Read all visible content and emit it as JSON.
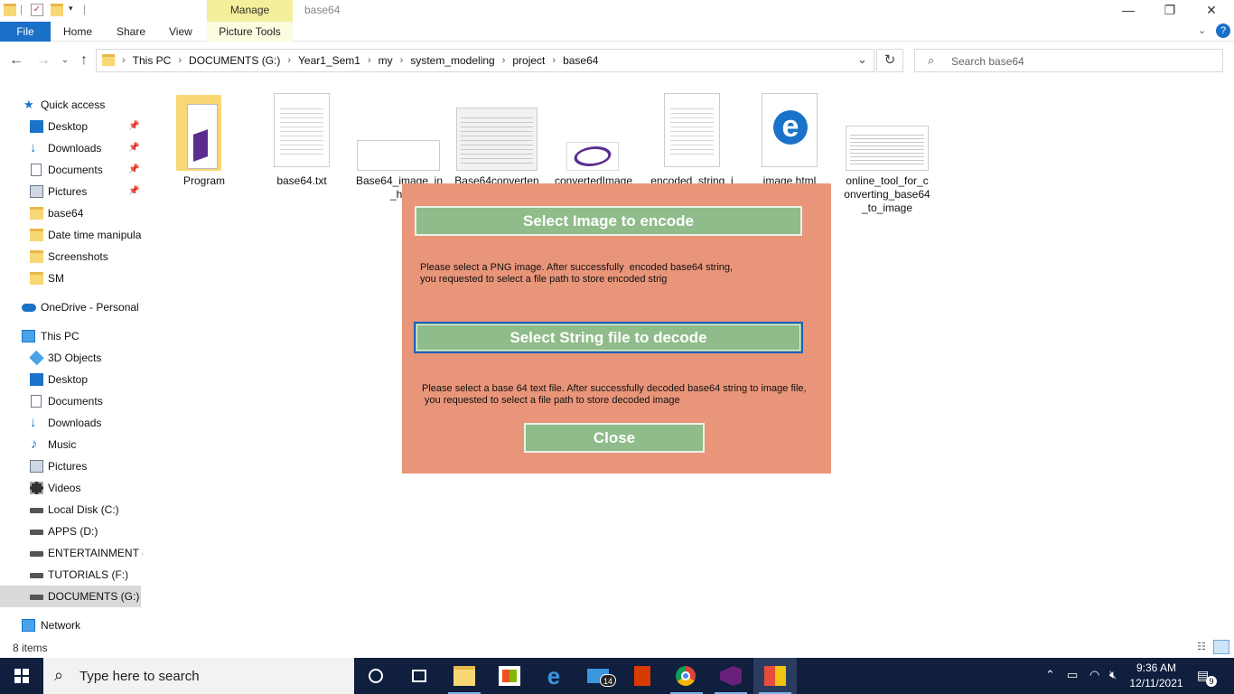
{
  "window": {
    "title": "base64",
    "manage_tab": "Manage",
    "minimize": "—",
    "maximize": "❐",
    "close": "✕"
  },
  "ribbon": {
    "file": "File",
    "home": "Home",
    "share": "Share",
    "view": "View",
    "picture_tools": "Picture Tools"
  },
  "address": {
    "crumbs": [
      "This PC",
      "DOCUMENTS (G:)",
      "Year1_Sem1",
      "my",
      "system_modeling",
      "project",
      "base64"
    ],
    "search_placeholder": "Search base64"
  },
  "nav": {
    "quick_access": "Quick access",
    "qa_items": [
      "Desktop",
      "Downloads",
      "Documents",
      "Pictures",
      "base64",
      "Date time manipula",
      "Screenshots",
      "SM"
    ],
    "onedrive": "OneDrive - Personal",
    "this_pc": "This PC",
    "pc_items": [
      "3D Objects",
      "Desktop",
      "Documents",
      "Downloads",
      "Music",
      "Pictures",
      "Videos",
      "Local Disk (C:)",
      "APPS (D:)",
      "ENTERTAINMENT (E",
      "TUTORIALS (F:)",
      "DOCUMENTS (G:)"
    ],
    "network": "Network"
  },
  "files": [
    {
      "line1": "Program",
      "line2": ""
    },
    {
      "line1": "base64.txt",
      "line2": ""
    },
    {
      "line1": "Base64_image_in",
      "line2": "_htı"
    },
    {
      "line1": "Base64converten",
      "line2": ""
    },
    {
      "line1": "convertedImage",
      "line2": ""
    },
    {
      "line1": "encoded_string_i",
      "line2": ""
    },
    {
      "line1": "image.html",
      "line2": ""
    },
    {
      "line1": "online_tool_for_c",
      "line2": "onverting_base64",
      "line3": "_to_image"
    }
  ],
  "dialog": {
    "encode_button": "Select Image to encode",
    "encode_help_1": "Please select a PNG image. After successfully  encoded base64 string,",
    "encode_help_2": "you requested to select a file path to store encoded strig",
    "decode_button": "Select String file to decode",
    "decode_help_1": "Please select a base 64 text file. After successfully decoded base64 string to image file,",
    "decode_help_2": " you requested to select a file path to store decoded image",
    "close_button": "Close"
  },
  "status": {
    "item_count": "8 items"
  },
  "taskbar": {
    "search_placeholder": "Type here to search",
    "mail_badge": "14",
    "time": "9:36 AM",
    "date": "12/11/2021",
    "notification_count": "9"
  },
  "colors": {
    "dialog_bg": "#e9957a",
    "button_bg": "#8fbc8a",
    "file_tab": "#1a6fc7",
    "taskbar": "#0f1f3d"
  }
}
